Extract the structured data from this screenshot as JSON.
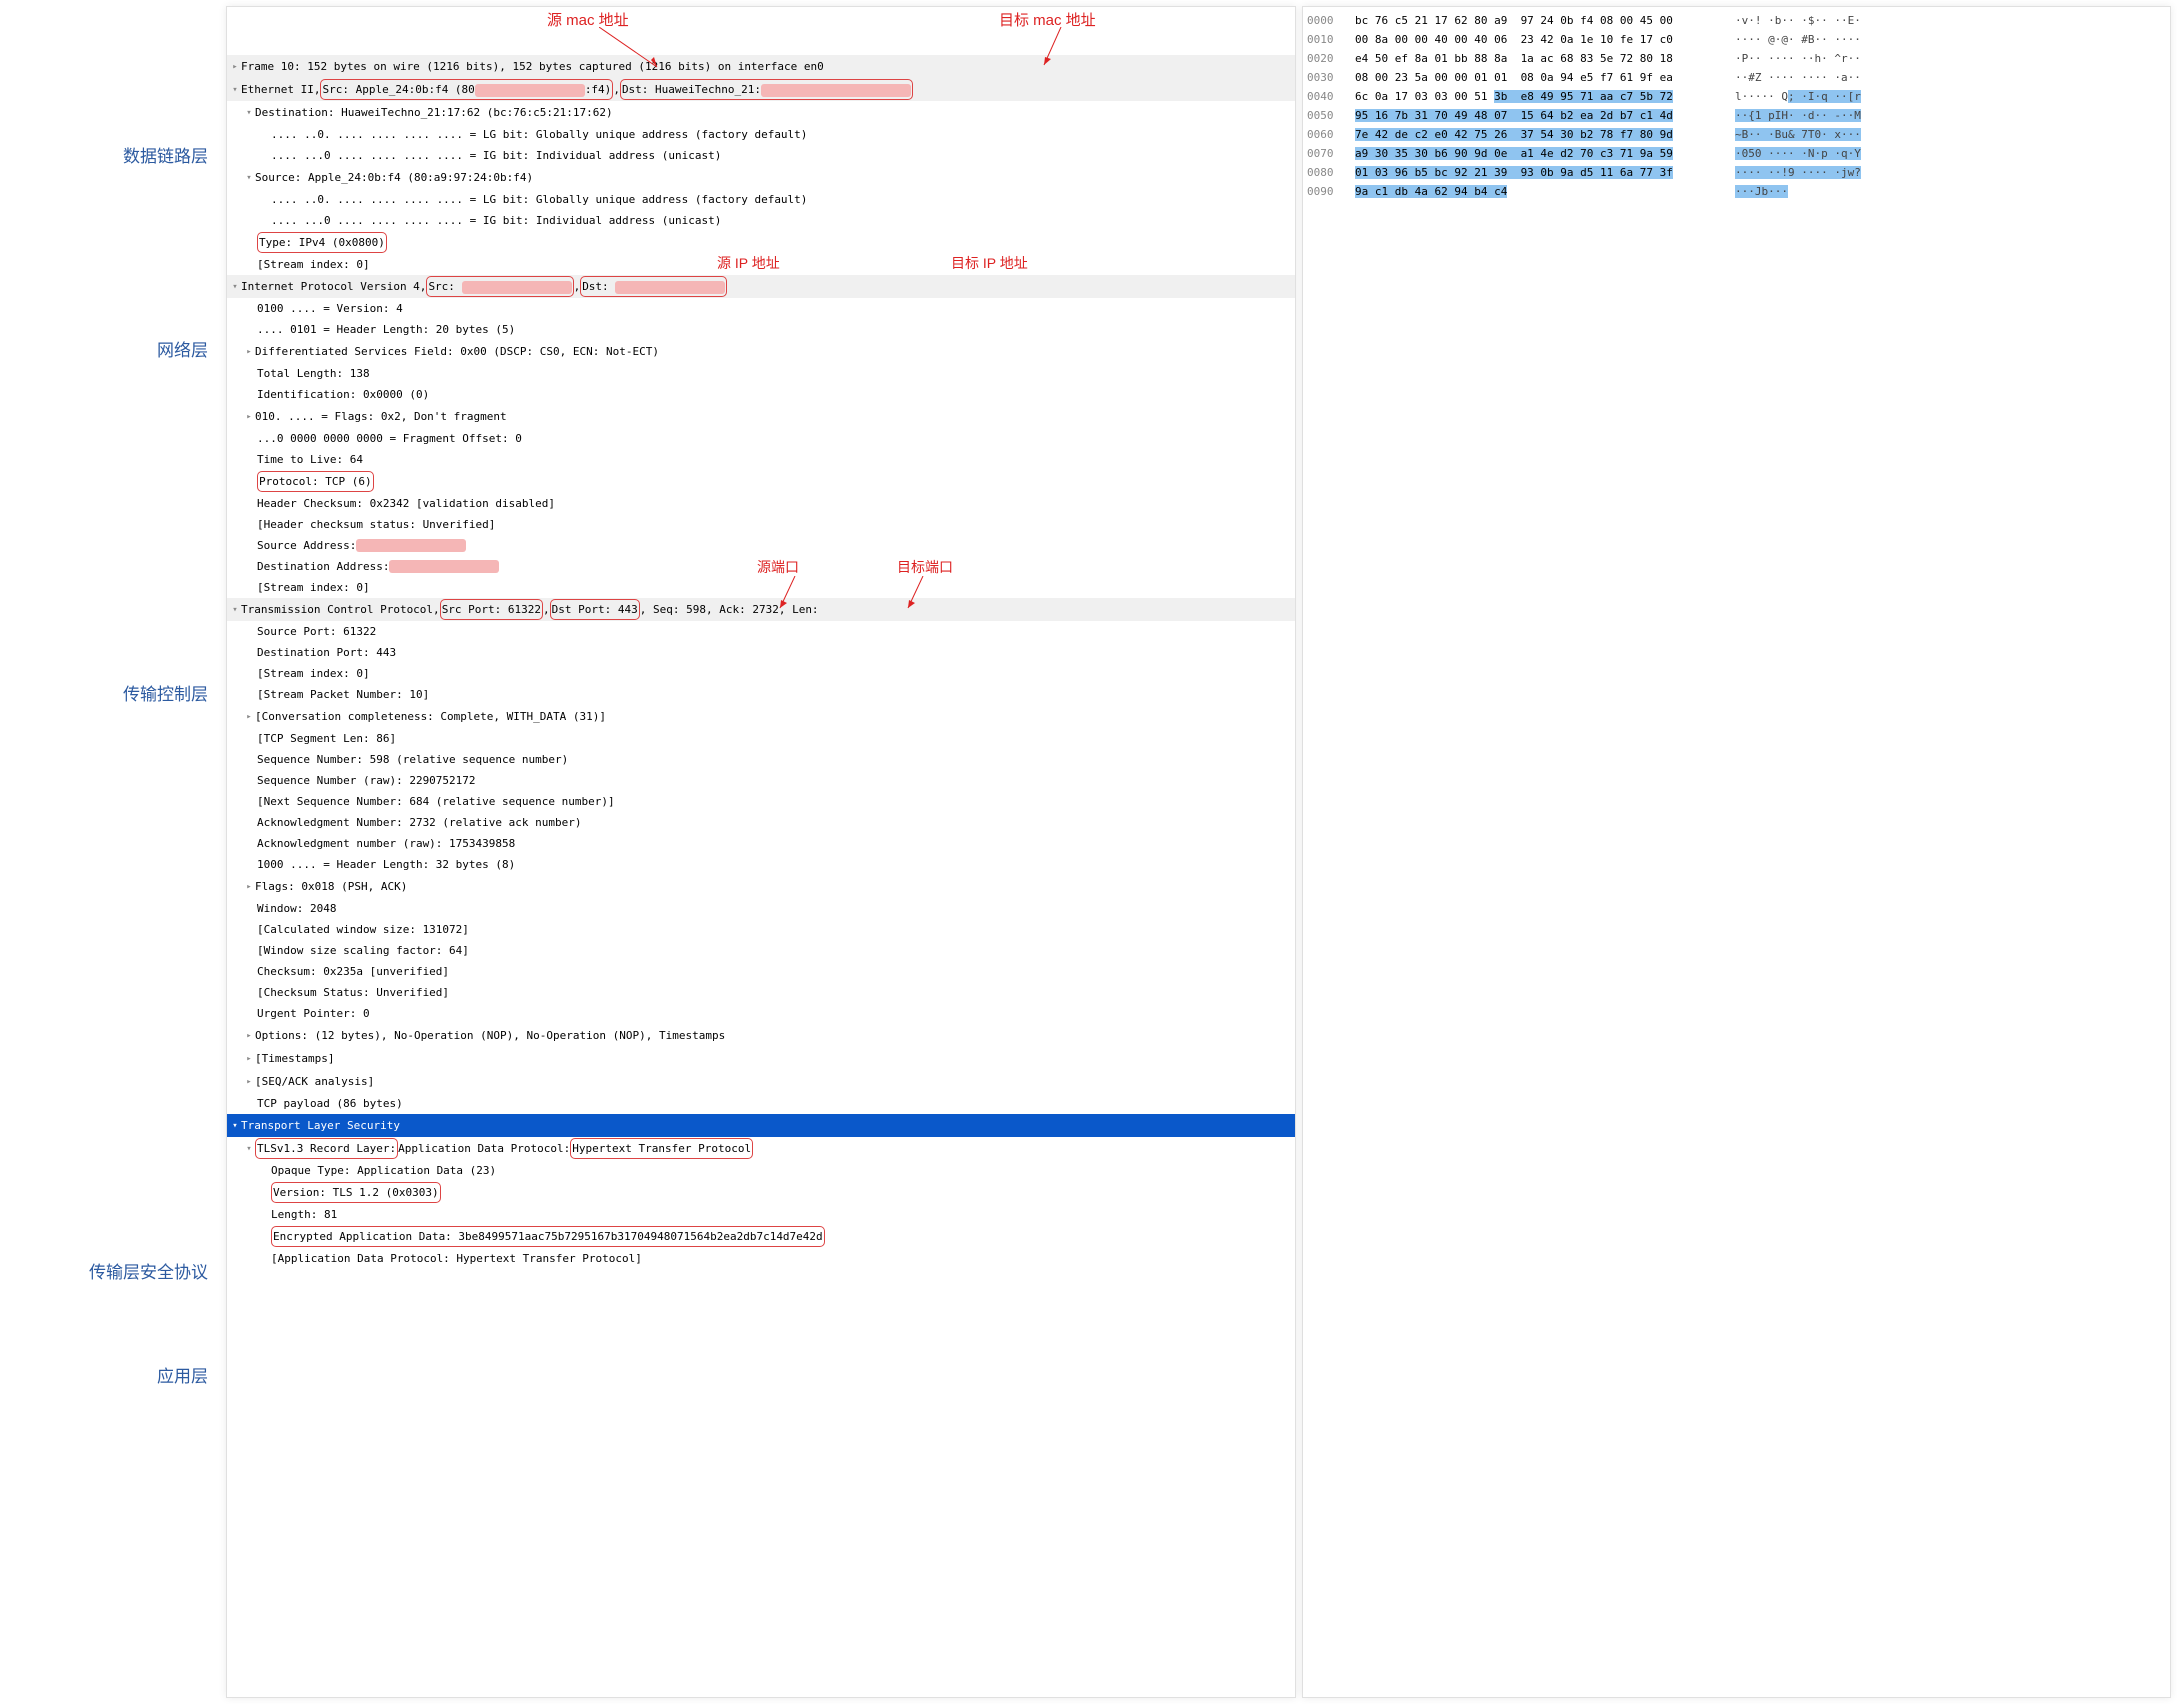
{
  "annotations": {
    "src_mac": "源 mac 地址",
    "dst_mac": "目标 mac 地址",
    "src_ip": "源 IP 地址",
    "dst_ip": "目标 IP 地址",
    "src_port": "源端口",
    "dst_port": "目标端口"
  },
  "labels": {
    "datalink": "数据链路层",
    "network": "网络层",
    "transport": "传输控制层",
    "tls": "传输层安全协议",
    "app": "应用层"
  },
  "tree": {
    "frame": "Frame 10: 152 bytes on wire (1216 bits), 152 bytes captured (1216 bits) on interface en0",
    "eth_prefix": "Ethernet II, ",
    "eth_src": "Src: Apple_24:0b:f4 (80",
    "eth_src_suffix": ":f4)",
    "eth_sep": ", ",
    "eth_dst": "Dst: HuaweiTechno_21:",
    "eth_destination": "Destination: HuaweiTechno_21:17:62 (bc:76:c5:21:17:62)",
    "eth_lg1": ".... ..0. .... .... .... .... = LG bit: Globally unique address (factory default)",
    "eth_ig1": ".... ...0 .... .... .... .... = IG bit: Individual address (unicast)",
    "eth_source": "Source: Apple_24:0b:f4 (80:a9:97:24:0b:f4)",
    "eth_lg2": ".... ..0. .... .... .... .... = LG bit: Globally unique address (factory default)",
    "eth_ig2": ".... ...0 .... .... .... .... = IG bit: Individual address (unicast)",
    "eth_type": "Type: IPv4 (0x0800)",
    "eth_stream": "[Stream index: 0]",
    "ip_header_prefix": "Internet Protocol Version 4, ",
    "ip_src_label": "Src: ",
    "ip_sep": ", ",
    "ip_dst_label": "Dst: ",
    "ip_version": "0100 .... = Version: 4",
    "ip_hdrlen": ".... 0101 = Header Length: 20 bytes (5)",
    "ip_dsfield": "Differentiated Services Field: 0x00 (DSCP: CS0, ECN: Not-ECT)",
    "ip_len": "Total Length: 138",
    "ip_id": "Identification: 0x0000 (0)",
    "ip_flags": "010. .... = Flags: 0x2, Don't fragment",
    "ip_fragoff": "...0 0000 0000 0000 = Fragment Offset: 0",
    "ip_ttl": "Time to Live: 64",
    "ip_proto": "Protocol: TCP (6)",
    "ip_checksum": "Header Checksum: 0x2342 [validation disabled]",
    "ip_chkstatus": "[Header checksum status: Unverified]",
    "ip_srcaddr": "Source Address: ",
    "ip_dstaddr": "Destination Address: ",
    "ip_stream": "[Stream index: 0]",
    "tcp_prefix": "Transmission Control Protocol, ",
    "tcp_srcport_hl": "Src Port: 61322",
    "tcp_sep": ", ",
    "tcp_dstport_hl": "Dst Port: 443",
    "tcp_suffix": ", Seq: 598, Ack: 2732, Len:",
    "tcp_srcport": "Source Port: 61322",
    "tcp_dstport": "Destination Port: 443",
    "tcp_stream": "[Stream index: 0]",
    "tcp_pnum": "[Stream Packet Number: 10]",
    "tcp_conv": "[Conversation completeness: Complete, WITH_DATA (31)]",
    "tcp_seglen": "[TCP Segment Len: 86]",
    "tcp_seqnum": "Sequence Number: 598    (relative sequence number)",
    "tcp_seqraw": "Sequence Number (raw): 2290752172",
    "tcp_nextseq": "[Next Sequence Number: 684    (relative sequence number)]",
    "tcp_acknum": "Acknowledgment Number: 2732    (relative ack number)",
    "tcp_ackraw": "Acknowledgment number (raw): 1753439858",
    "tcp_hdrlen": "1000 .... = Header Length: 32 bytes (8)",
    "tcp_flags": "Flags: 0x018 (PSH, ACK)",
    "tcp_window": "Window: 2048",
    "tcp_calcwin": "[Calculated window size: 131072]",
    "tcp_winscale": "[Window size scaling factor: 64]",
    "tcp_checksum": "Checksum: 0x235a [unverified]",
    "tcp_chkstatus": "[Checksum Status: Unverified]",
    "tcp_urgent": "Urgent Pointer: 0",
    "tcp_options": "Options: (12 bytes), No-Operation (NOP), No-Operation (NOP), Timestamps",
    "tcp_timestamps": "[Timestamps]",
    "tcp_seqack": "[SEQ/ACK analysis]",
    "tcp_payload": "TCP payload (86 bytes)",
    "tls_header": "Transport Layer Security",
    "tls_record_prefix": "TLSv1.3 Record Layer:",
    "tls_record_mid": " Application Data Protocol: ",
    "tls_record_proto": "Hypertext Transfer Protocol",
    "tls_opaque": "Opaque Type: Application Data (23)",
    "tls_version": "Version: TLS 1.2 (0x0303)",
    "tls_length": "Length: 81",
    "tls_encdata": "Encrypted Application Data: 3be8499571aac75b7295167b31704948071564b2ea2db7c14d7e42d",
    "tls_appproto": "[Application Data Protocol: Hypertext Transfer Protocol]"
  },
  "hex": [
    {
      "off": "0000",
      "bytes": "bc 76 c5 21 17 62 80 a9  97 24 0b f4 08 00 45 00",
      "ascii": "·v·! ·b·· ·$·· ··E·"
    },
    {
      "off": "0010",
      "bytes": "00 8a 00 00 40 00 40 06  23 42 0a 1e 10 fe 17 c0",
      "ascii": "···· @·@· #B·· ····"
    },
    {
      "off": "0020",
      "bytes": "e4 50 ef 8a 01 bb 88 8a  1a ac 68 83 5e 72 80 18",
      "ascii": "·P·· ···· ··h· ^r··"
    },
    {
      "off": "0030",
      "bytes": "08 00 23 5a 00 00 01 01  08 0a 94 e5 f7 61 9f ea",
      "ascii": "··#Z ···· ···· ·a··"
    },
    {
      "off": "0040",
      "bytes": "6c 0a 17 03 03 00 51 ",
      "bytes_hl": "3b  e8 49 95 71 aa c7 5b 72",
      "ascii": "l····· Q",
      "ascii_hl": "; ·I·q ··[r"
    },
    {
      "off": "0050",
      "bytes_hl": "95 16 7b 31 70 49 48 07  15 64 b2 ea 2d b7 c1 4d",
      "ascii_hl": "··{1 pIH· ·d·· -··M"
    },
    {
      "off": "0060",
      "bytes_hl": "7e 42 de c2 e0 42 75 26  37 54 30 b2 78 f7 80 9d",
      "ascii_hl": "~B·· ·Bu& 7T0· x···"
    },
    {
      "off": "0070",
      "bytes_hl": "a9 30 35 30 b6 90 9d 0e  a1 4e d2 70 c3 71 9a 59",
      "ascii_hl": "·050 ···· ·N·p ·q·Y"
    },
    {
      "off": "0080",
      "bytes_hl": "01 03 96 b5 bc 92 21 39  93 0b 9a d5 11 6a 77 3f",
      "ascii_hl": "···· ··!9 ···· ·jw?"
    },
    {
      "off": "0090",
      "bytes_hl": "9a c1 db 4a 62 94 b4 c4",
      "ascii_hl": "···Jb···"
    }
  ]
}
